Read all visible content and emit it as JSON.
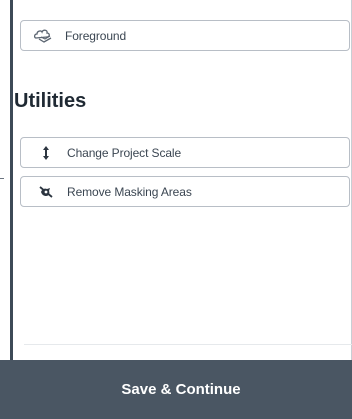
{
  "panel": {
    "layers": [
      {
        "label": "Foreground",
        "icon": "layers-cloud-icon"
      }
    ],
    "utilities_title": "Utilities",
    "utilities": [
      {
        "label": "Change Project Scale",
        "icon": "vertical-arrows-icon"
      },
      {
        "label": "Remove Masking Areas",
        "icon": "mask-off-icon"
      }
    ]
  },
  "footer": {
    "save_label": "Save & Continue"
  },
  "colors": {
    "footer_bg": "#4a5663",
    "border": "#b8bec6",
    "text": "#3b4652",
    "heading": "#1f2933"
  }
}
